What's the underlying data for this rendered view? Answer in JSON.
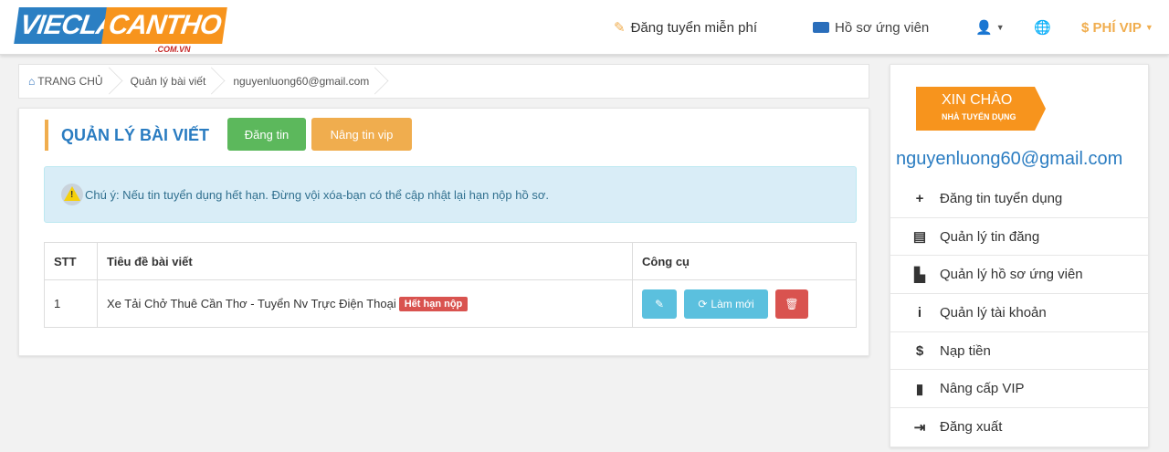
{
  "header": {
    "logo_part1": "VIECLAM",
    "logo_part2": "CANTHO",
    "logo_sub": ".COM.VN",
    "nav_post": "Đăng tuyển miễn phí",
    "nav_cv": "Hồ sơ ứng viên",
    "nav_vip": "$ PHÍ VIP",
    "icons": [
      "edit-icon",
      "id-card-icon",
      "user-icon",
      "globe-icon"
    ]
  },
  "breadcrumb": [
    "TRANG CHỦ",
    "Quản lý bài viết",
    "nguyenluong60@gmail.com"
  ],
  "main": {
    "title": "QUẢN LÝ BÀI VIẾT",
    "btn_post": "Đăng tin",
    "btn_vip": "Nâng tin vip",
    "alert": "Chú ý: Nếu tin tuyển dụng hết hạn. Đừng vội xóa-bạn có thể cập nhật lại hạn nộp hồ sơ.",
    "table": {
      "headers": [
        "STT",
        "Tiêu đề bài viết",
        "Công cụ"
      ],
      "rows": [
        {
          "stt": "1",
          "title": "Xe Tải Chở Thuê Cần Thơ - Tuyển Nv Trực Điện Thoại",
          "badge": "Hết hạn nộp",
          "refresh": "Làm mới"
        }
      ]
    }
  },
  "sidebar": {
    "hello": "XIN CHÀO",
    "role": "NHÀ TUYỂN DỤNG",
    "email": "nguyenluong60@gmail.com",
    "menu": [
      {
        "icon": "plus-icon",
        "label": "Đăng tin tuyển dụng"
      },
      {
        "icon": "list-icon",
        "label": "Quản lý tin đăng"
      },
      {
        "icon": "file-icon",
        "label": "Quản lý hồ sơ ứng viên"
      },
      {
        "icon": "info-icon",
        "label": "Quản lý tài khoản"
      },
      {
        "icon": "dollar-icon",
        "label": "Nạp tiền"
      },
      {
        "icon": "upgrade-icon",
        "label": "Nâng cấp VIP"
      },
      {
        "icon": "logout-icon",
        "label": "Đăng xuất"
      }
    ]
  },
  "colors": {
    "brand_blue": "#2a7cc1",
    "brand_orange": "#f7941d",
    "success": "#5cb85c",
    "warning": "#f0ad4e",
    "danger": "#d9534f",
    "info": "#5bc0de"
  }
}
